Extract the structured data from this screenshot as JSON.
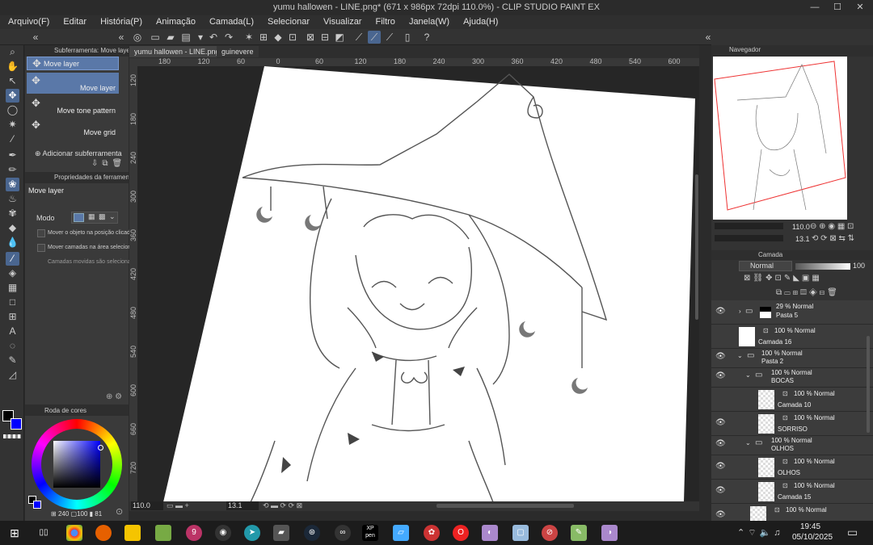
{
  "title": "yumu hallowen - LINE.png* (671 x 986px 72dpi 110.0%)  -  CLIP STUDIO PAINT EX",
  "menu": [
    "Arquivo(F)",
    "Editar",
    "História(P)",
    "Animação",
    "Camada(L)",
    "Selecionar",
    "Visualizar",
    "Filtro",
    "Janela(W)",
    "Ajuda(H)"
  ],
  "doc_tabs": [
    "yumu hallowen - LINE.png*",
    "guinevere"
  ],
  "subtool": {
    "header": "Subferramenta: Move layer",
    "items": [
      "Move layer",
      "Move layer",
      "Move tone pattern",
      "Move grid"
    ],
    "add": "Adicionar subferramenta"
  },
  "toolprops": {
    "header": "Propriedades da ferramenta",
    "name": "Move layer",
    "mode_label": "Modo",
    "options": [
      "Mover o objeto na posição clicada",
      "Mover camadas na área selecionada",
      "Camadas movidas são selecionadas"
    ]
  },
  "color": {
    "header": "Roda de cores",
    "main": "#000000",
    "sub": "#0000ff",
    "hsv": [
      "240",
      "100",
      "81"
    ]
  },
  "ruler_h": [
    "180",
    "120",
    "60",
    "0",
    "60",
    "120",
    "180",
    "240",
    "300",
    "360",
    "420",
    "480",
    "540",
    "600"
  ],
  "ruler_v": [
    "120",
    "180",
    "240",
    "300",
    "360",
    "420",
    "480",
    "540",
    "600",
    "660",
    "720"
  ],
  "status": {
    "zoom": "110.0",
    "angle": "13.1"
  },
  "navigator": {
    "header": "Navegador",
    "zoom": "110.0",
    "angle": "13.1"
  },
  "layers_panel": {
    "header": "Camada",
    "blend": "Normal",
    "opacity": "100",
    "layers": [
      {
        "mode": "29 % Normal",
        "name": "Pasta 5",
        "type": "folder"
      },
      {
        "mode": "100 % Normal",
        "name": "Camada 16",
        "type": "layer"
      },
      {
        "mode": "100 % Normal",
        "name": "Pasta 2",
        "type": "folder"
      },
      {
        "mode": "100 % Normal",
        "name": "BOCAS",
        "type": "folder"
      },
      {
        "mode": "100 % Normal",
        "name": "Camada 10",
        "type": "layer"
      },
      {
        "mode": "100 % Normal",
        "name": "SORRISO",
        "type": "layer"
      },
      {
        "mode": "100 % Normal",
        "name": "OLHOS",
        "type": "folder"
      },
      {
        "mode": "100 % Normal",
        "name": "OLHOS",
        "type": "layer"
      },
      {
        "mode": "100 % Normal",
        "name": "Camada 15",
        "type": "layer"
      },
      {
        "mode": "100 % Normal",
        "name": "",
        "type": "layer"
      }
    ]
  },
  "taskbar": {
    "time": "19:45",
    "date": "05/10/2025"
  }
}
